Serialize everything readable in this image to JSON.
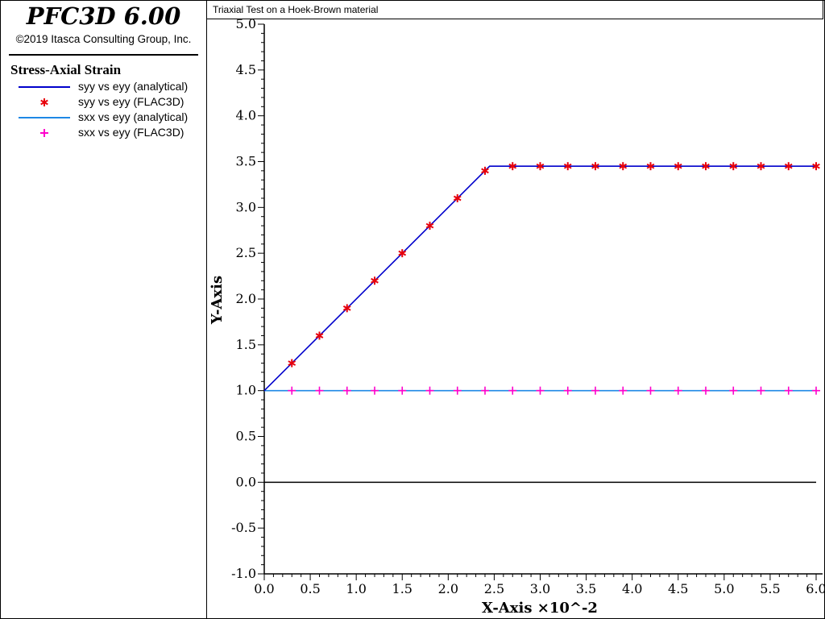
{
  "app": {
    "title": "PFC3D 6.00",
    "copyright": "©2019 Itasca Consulting Group, Inc."
  },
  "legend": {
    "title": "Stress-Axial Strain",
    "entries": [
      {
        "label": "syy vs eyy (analytical)",
        "style": "line",
        "color": "#0000cc"
      },
      {
        "label": "syy vs eyy (FLAC3D)",
        "style": "asterisk",
        "color": "#e8000b"
      },
      {
        "label": "sxx vs eyy (analytical)",
        "style": "line",
        "color": "#1e88e5"
      },
      {
        "label": "sxx vs eyy (FLAC3D)",
        "style": "plus",
        "color": "#ff00cc"
      }
    ]
  },
  "chart_data": {
    "type": "line",
    "title": "Triaxial Test on a Hoek-Brown material",
    "xlabel": "X-Axis ×10^-2",
    "ylabel": "Y-Axis",
    "xlim": [
      0.0,
      6.0
    ],
    "ylim": [
      -1.0,
      5.0
    ],
    "x_ticks": [
      "0.0",
      "0.5",
      "1.0",
      "1.5",
      "2.0",
      "2.5",
      "3.0",
      "3.5",
      "4.0",
      "4.5",
      "5.0",
      "5.5",
      "6.0"
    ],
    "y_ticks": [
      "-1.0",
      "-0.5",
      "0.0",
      "0.5",
      "1.0",
      "1.5",
      "2.0",
      "2.5",
      "3.0",
      "3.5",
      "4.0",
      "4.5",
      "5.0"
    ],
    "grid": false,
    "zero_line": true,
    "series": [
      {
        "name": "syy vs eyy (analytical)",
        "kind": "line",
        "color": "#0000cc",
        "x": [
          0.0,
          2.45,
          6.0
        ],
        "y": [
          1.0,
          3.45,
          3.45
        ]
      },
      {
        "name": "syy vs eyy (FLAC3D)",
        "kind": "asterisk",
        "color": "#e8000b",
        "x": [
          0.3,
          0.6,
          0.9,
          1.2,
          1.5,
          1.8,
          2.1,
          2.4,
          2.7,
          3.0,
          3.3,
          3.6,
          3.9,
          4.2,
          4.5,
          4.8,
          5.1,
          5.4,
          5.7,
          6.0
        ],
        "y": [
          1.3,
          1.6,
          1.9,
          2.2,
          2.5,
          2.8,
          3.1,
          3.4,
          3.45,
          3.45,
          3.45,
          3.45,
          3.45,
          3.45,
          3.45,
          3.45,
          3.45,
          3.45,
          3.45,
          3.45
        ]
      },
      {
        "name": "sxx vs eyy (analytical)",
        "kind": "line",
        "color": "#1e88e5",
        "x": [
          0.0,
          6.0
        ],
        "y": [
          1.0,
          1.0
        ]
      },
      {
        "name": "sxx vs eyy (FLAC3D)",
        "kind": "plus",
        "color": "#ff00cc",
        "x": [
          0.3,
          0.6,
          0.9,
          1.2,
          1.5,
          1.8,
          2.1,
          2.4,
          2.7,
          3.0,
          3.3,
          3.6,
          3.9,
          4.2,
          4.5,
          4.8,
          5.1,
          5.4,
          5.7,
          6.0
        ],
        "y": [
          1.0,
          1.0,
          1.0,
          1.0,
          1.0,
          1.0,
          1.0,
          1.0,
          1.0,
          1.0,
          1.0,
          1.0,
          1.0,
          1.0,
          1.0,
          1.0,
          1.0,
          1.0,
          1.0,
          1.0
        ]
      }
    ]
  }
}
